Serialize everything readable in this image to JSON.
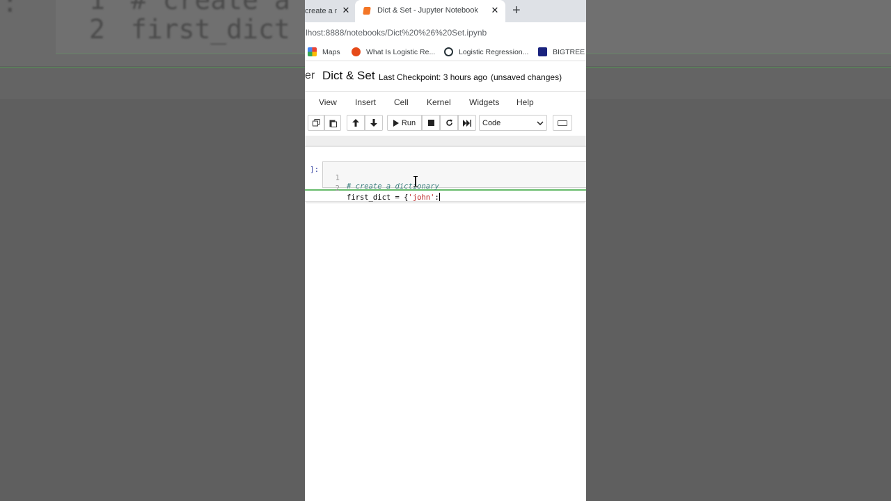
{
  "background": {
    "code_line1": "# create a d",
    "code_line2": "first_dict =",
    "line_num1": "1",
    "line_num2": "2",
    "prompt_tail": "]:"
  },
  "browser": {
    "tabs": [
      {
        "title": "create a n"
      },
      {
        "title": "Dict & Set - Jupyter Notebook"
      }
    ],
    "new_tab": "+",
    "close_glyph": "✕",
    "url": "lhost:8888/notebooks/Dict%20%26%20Set.ipynb",
    "bookmarks": [
      {
        "label": "Maps"
      },
      {
        "label": "What Is Logistic Re..."
      },
      {
        "label": "Logistic Regression..."
      },
      {
        "label": "BIGTREE E"
      }
    ]
  },
  "jupyter": {
    "logo_tail": "er",
    "notebook_title": "Dict & Set",
    "checkpoint": "Last Checkpoint: 3 hours ago",
    "unsaved": "(unsaved changes)",
    "menu": [
      "View",
      "Insert",
      "Cell",
      "Kernel",
      "Widgets",
      "Help"
    ],
    "toolbar": {
      "run_label": "Run",
      "cell_type": "Code"
    },
    "cell": {
      "prompt": "]:",
      "lines": [
        {
          "num": "1",
          "comment": "# create a dictionary"
        },
        {
          "num": "2",
          "code_prefix": "first_dict = {",
          "string": "'john'",
          "code_suffix": ":"
        }
      ]
    }
  },
  "icons": [
    "copy-icon",
    "paste-icon",
    "arrow-up-icon",
    "arrow-down-icon",
    "play-icon",
    "stop-icon",
    "restart-icon",
    "fast-forward-icon",
    "keyboard-icon",
    "chevron-down-icon",
    "text-cursor-icon"
  ]
}
